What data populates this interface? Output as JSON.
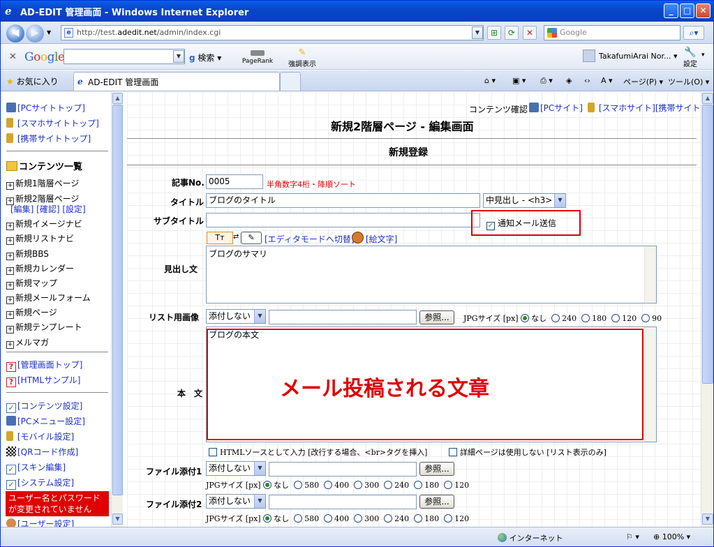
{
  "window": {
    "title": "AD-EDIT 管理画面 - Windows Internet Explorer"
  },
  "address": {
    "prefix": "http://test.",
    "domain": "adedit.net",
    "path": "/admin/index.cgi",
    "search_placeholder": "Google"
  },
  "google_toolbar": {
    "logo": "Google",
    "search_label": "検索",
    "pagerank_label": "PageRank",
    "highlight_label": "強調表示",
    "user": "TakafumiArai Nor...",
    "settings_label": "設定"
  },
  "tabs": {
    "favorites_label": "お気に入り",
    "active_tab": "AD-EDIT 管理画面",
    "page_menu": "ページ(P)",
    "tools_menu": "ツール(O)"
  },
  "sidebar": {
    "top_links": [
      "[PCサイトトップ]",
      "[スマホサイトトップ]",
      "[携帯サイトトップ]"
    ],
    "content_heading": "コンテンツ一覧",
    "new_items": [
      "新規1階層ページ",
      "新規2階層ページ",
      "新規イメージナビ",
      "新規リストナビ",
      "新規BBS",
      "新規カレンダー",
      "新規マップ",
      "新規メールフォーム",
      "新規ページ",
      "新規テンプレート",
      "メルマガ"
    ],
    "sub_links": "[編集] [確認] [設定]",
    "help_links": [
      "[管理画面トップ]",
      "[HTMLサンプル]"
    ],
    "settings_links": [
      "[コンテンツ設定]",
      "[PCメニュー設定]",
      "[モバイル設定]",
      "[QRコード作成]",
      "[スキン編集]",
      "[システム設定]"
    ],
    "warning": "ユーザー名とパスワードが変更されていません",
    "user_settings": "[ユーザー設定]"
  },
  "main": {
    "confirm_label": "コンテンツ確認",
    "pc_site": "[PCサイト]",
    "mobile_site": "[スマホサイト][携帯サイト]",
    "page_title": "新規2階層ページ - 編集画面",
    "section_title": "新規登録",
    "article_no_label": "記事No.",
    "article_no_value": "0005",
    "article_no_note": "半角数字4桁・降順ソート",
    "title_label": "タイトル",
    "title_value": "ブログのタイトル",
    "heading_select": "中見出し - <h3>",
    "subtitle_label": "サブタイトル",
    "notify_label": "通知メール送信",
    "editor_mode_link": "[エディタモードへ切替]",
    "emoji_link": "[絵文字]",
    "heading_text_label": "見出し文",
    "heading_text_value": "ブログのサマリ",
    "list_image_label": "リスト用画像",
    "attach_none": "添付しない",
    "browse_label": "参照...",
    "jpg_size_label": "JPGサイズ [px]",
    "list_sizes": [
      "なし",
      "240",
      "180",
      "120",
      "90"
    ],
    "body_label": "本　文",
    "body_value": "ブログの本文",
    "annotation": "メール投稿される文章",
    "html_source_label": "HTMLソースとして入力 [改行する場合、<br>タグを挿入]",
    "detail_unused_label": "詳細ページは使用しない [リスト表示のみ]",
    "file1_label": "ファイル添付1",
    "file2_label": "ファイル添付2",
    "jpg_size_label2": "JPGサイズ [px]",
    "file_sizes": [
      "なし",
      "580",
      "400",
      "300",
      "240",
      "180",
      "120"
    ]
  },
  "statusbar": {
    "zone": "インターネット",
    "zoom": "100%"
  },
  "colors": {
    "link": "#1d2fc9",
    "alert_red": "#e00000"
  }
}
